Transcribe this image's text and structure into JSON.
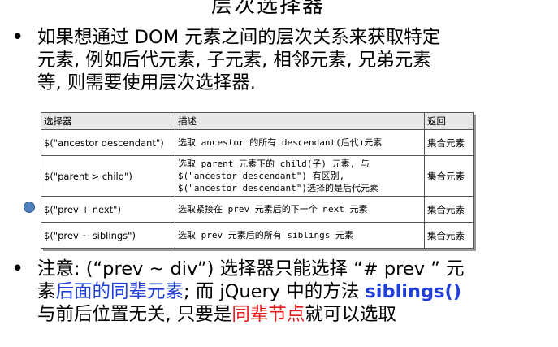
{
  "slide": {
    "title_fragment": "层次选择器"
  },
  "bullet1": {
    "marker": "•",
    "lines": [
      "如果想通过 DOM 元素之间的层次关系来获取特定",
      "元素, 例如后代元素, 子元素, 相邻元素, 兄弟元素",
      "等, 则需要使用层次选择器."
    ]
  },
  "table": {
    "headers": [
      "选择器",
      "描述",
      "返回"
    ],
    "rows": [
      {
        "selector": "$(\"ancestor descendant\")",
        "desc": [
          "选取 ancestor 的所有 descendant(后代)元素"
        ],
        "ret": "集合元素"
      },
      {
        "selector": "$(\"parent > child\")",
        "desc": [
          "选取 parent 元素下的 child(子) 元素, 与",
          "$(\"ancestor descendant\") 有区别,",
          "$(\"ancestor descendant\")选择的是后代元素"
        ],
        "ret": "集合元素"
      },
      {
        "selector": "$(\"prev + next\")",
        "desc": [
          "选取紧接在 prev 元素后的下一个 next 元素"
        ],
        "ret": "集合元素"
      },
      {
        "selector": "$(\"prev ~ siblings\")",
        "desc": [
          "选取 prev 元素后的所有 siblings 元素"
        ],
        "ret": "集合元素"
      }
    ]
  },
  "bullet2": {
    "marker": "•",
    "line1_a": "注意: (“prev ~ div”) 选择器只能选择 “# prev ” 元",
    "line2_a": "素",
    "line2_blue": "后面的同辈元素",
    "line2_b": "; 而 jQuery 中的方法 ",
    "line2_bold": "siblings()",
    "line3_a": "与前后位置无关, 只要是",
    "line3_red": "同辈节点",
    "line3_b": "就可以选取"
  },
  "colors": {
    "highlight_blue": "#1f3fd6",
    "highlight_red": "#e51c1c",
    "marker_circle": "#4f81bd"
  }
}
